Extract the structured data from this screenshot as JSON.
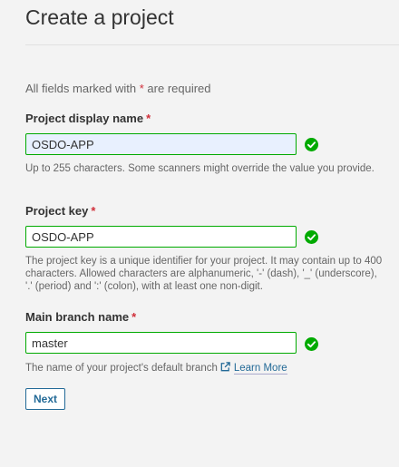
{
  "header": {
    "title": "Create a project"
  },
  "form": {
    "required_note_prefix": "All fields marked with",
    "required_note_star": "*",
    "required_note_suffix": "are required",
    "required_star": "*",
    "fields": [
      {
        "label": "Project display name",
        "value": "OSDO-APP",
        "help": "Up to 255 characters. Some scanners might override the value you provide.",
        "status_icon": "check-circle-icon",
        "valid": true
      },
      {
        "label": "Project key",
        "value": "OSDO-APP",
        "help": "The project key is a unique identifier for your project. It may contain up to 400 characters. Allowed characters are alphanumeric, '-' (dash), '_' (underscore), '.' (period) and ':' (colon), with at least one non-digit.",
        "status_icon": "check-circle-icon",
        "valid": true
      },
      {
        "label": "Main branch name",
        "value": "master",
        "help": "The name of your project's default branch",
        "link_icon": "external-link-icon",
        "link_text": "Learn More",
        "status_icon": "check-circle-icon",
        "valid": true
      }
    ],
    "next_label": "Next"
  },
  "colors": {
    "valid_border": "#00aa00",
    "check": "#00aa00",
    "required_star": "#d02f3a",
    "link": "#236a97",
    "autofill_bg": "#e8f0fe"
  }
}
